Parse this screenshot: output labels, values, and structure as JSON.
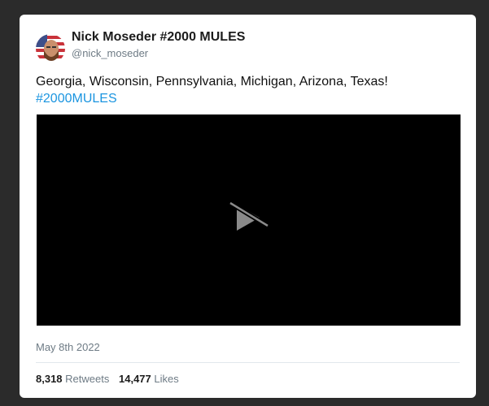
{
  "tweet": {
    "author_name": "Nick Moseder #2000 MULES",
    "author_handle": "@nick_moseder",
    "text": "Georgia, Wisconsin, Pennsylvania, Michigan, Arizona, Texas!",
    "hashtag": "#2000MULES",
    "date": "May 8th 2022",
    "retweets_count": "8,318",
    "retweets_label": "Retweets",
    "likes_count": "14,477",
    "likes_label": "Likes"
  },
  "video": {
    "icon": "play-icon-unavailable"
  },
  "colors": {
    "background": "#2b2b2b",
    "card": "#ffffff",
    "link": "#1b95e0",
    "muted": "#6e7b85",
    "video_bg": "#000000"
  }
}
